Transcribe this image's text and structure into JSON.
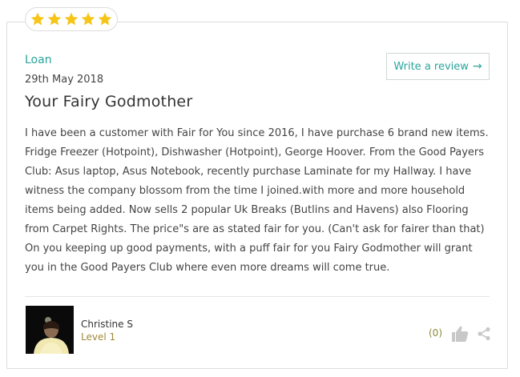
{
  "rating": {
    "stars": 5,
    "star_color": "#f5c518"
  },
  "review": {
    "reviewer_tag": "Loan",
    "date": "29th May 2018",
    "title": "Your Fairy Godmother",
    "text": "I have been a customer with Fair for You since 2016, I have purchase 6 brand new items. Fridge Freezer (Hotpoint), Dishwasher (Hotpoint), George Hoover. From the Good Payers Club: Asus laptop, Asus Notebook, recently purchase Laminate for my Hallway. I have witness the company blossom from the time I joined.with more and more household items being added. Now sells 2 popular Uk Breaks (Butlins and Havens) also Flooring from Carpet Rights. The price\"s are as stated fair for you. (Can't ask for fairer than that) On you keeping up good payments, with a puff fair for you Fairy Godmother will grant you in the Good Payers Club where even more dreams will come true."
  },
  "actions": {
    "write_review_label": "Write a review",
    "write_review_icon": "arrow-right-icon"
  },
  "author": {
    "name": "Christine S",
    "level": "Level 1"
  },
  "feedback": {
    "helpful_count": "(0)",
    "thumb_icon": "thumbs-up-icon",
    "share_icon": "share-icon"
  },
  "colors": {
    "accent": "#2aa59a",
    "level": "#a08a3a",
    "star": "#f5c518"
  }
}
